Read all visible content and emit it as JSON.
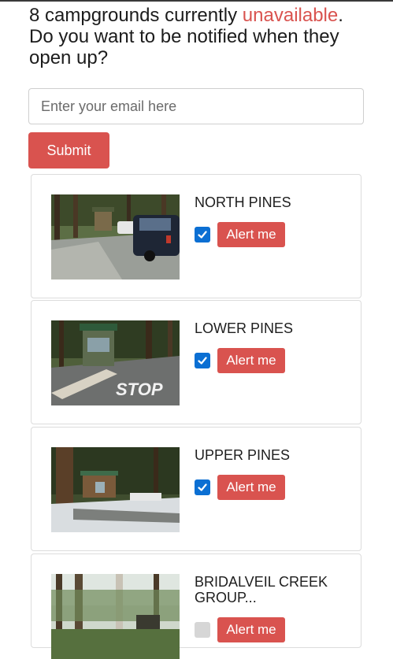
{
  "header": {
    "count_text": "8 campgrounds currently ",
    "status_word": "unavailable",
    "after_status": ".",
    "question": "Do you want to be notified when they open up?"
  },
  "form": {
    "email_placeholder": "Enter your email here",
    "email_value": "",
    "submit_label": "Submit"
  },
  "colors": {
    "accent": "#d9534f",
    "checkbox_checked": "#0b6fd3"
  },
  "campgrounds": [
    {
      "name": "NORTH PINES",
      "checked": true,
      "alert_label": "Alert me",
      "image": "north-pines-photo"
    },
    {
      "name": "LOWER PINES",
      "checked": true,
      "alert_label": "Alert me",
      "image": "lower-pines-photo"
    },
    {
      "name": "UPPER PINES",
      "checked": true,
      "alert_label": "Alert me",
      "image": "upper-pines-photo"
    },
    {
      "name": "BRIDALVEIL CREEK GROUP...",
      "checked": false,
      "alert_label": "Alert me",
      "image": "bridalveil-creek-photo"
    }
  ]
}
